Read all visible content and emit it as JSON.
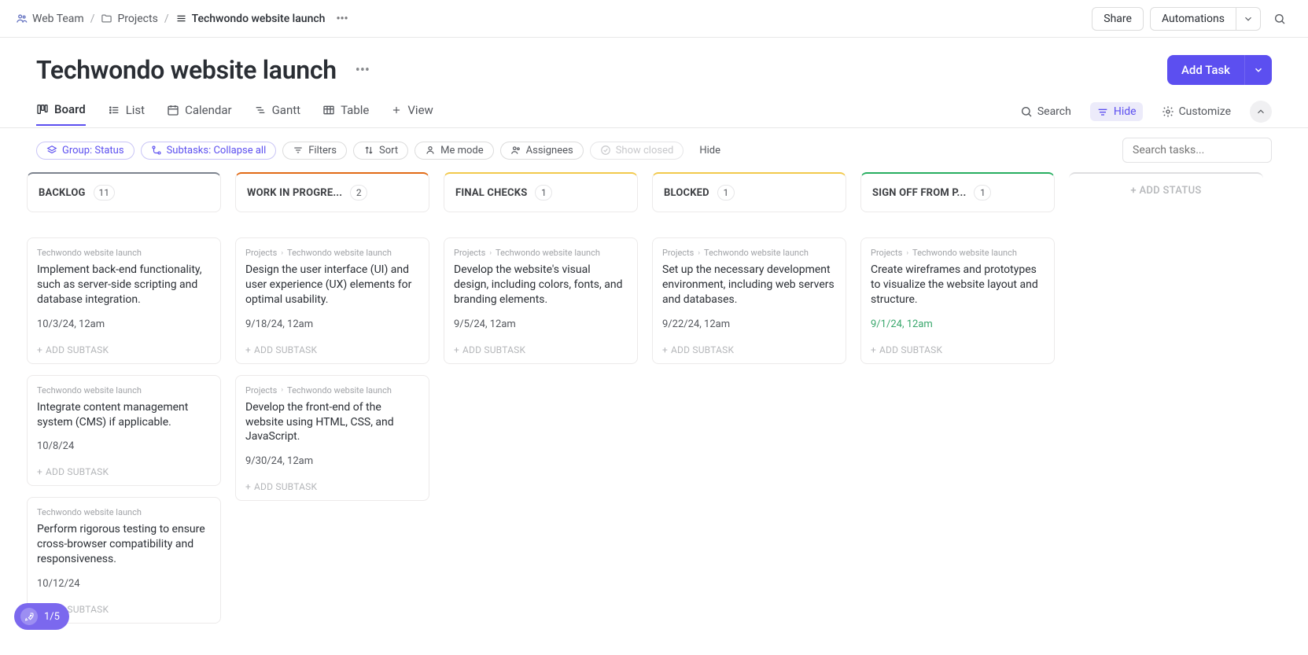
{
  "breadcrumb": {
    "team": "Web Team",
    "projects": "Projects",
    "current": "Techwondo website launch"
  },
  "header": {
    "share": "Share",
    "automations": "Automations"
  },
  "page": {
    "title": "Techwondo website launch",
    "add_task": "Add Task"
  },
  "views": {
    "board": "Board",
    "list": "List",
    "calendar": "Calendar",
    "gantt": "Gantt",
    "table": "Table",
    "view": "View",
    "search": "Search",
    "hide": "Hide",
    "customize": "Customize"
  },
  "filters": {
    "group": "Group: Status",
    "subtasks": "Subtasks: Collapse all",
    "filters": "Filters",
    "sort": "Sort",
    "me_mode": "Me mode",
    "assignees": "Assignees",
    "show_closed": "Show closed",
    "hide": "Hide",
    "search_placeholder": "Search tasks..."
  },
  "add_status": "+ ADD STATUS",
  "add_subtask": "ADD SUBTASK",
  "columns": [
    {
      "name": "BACKLOG",
      "count": "11",
      "color": "#7c828d",
      "cards": [
        {
          "crumb1": "Techwondo website launch",
          "title": "Implement back-end functionality, such as server-side scripting and database integration.",
          "date": "10/3/24, 12am"
        },
        {
          "crumb1": "Techwondo website launch",
          "title": "Integrate content management system (CMS) if applicable.",
          "date": "10/8/24"
        },
        {
          "crumb1": "Techwondo website launch",
          "title": "Perform rigorous testing to ensure cross-browser compatibility and responsiveness.",
          "date": "10/12/24"
        }
      ]
    },
    {
      "name": "WORK IN PROGRE...",
      "count": "2",
      "color": "#e16b16",
      "cards": [
        {
          "crumb0": "Projects",
          "crumb1": "Techwondo website launch",
          "title": "Design the user interface (UI) and user experience (UX) elements for optimal usability.",
          "date": "9/18/24, 12am"
        },
        {
          "crumb0": "Projects",
          "crumb1": "Techwondo website launch",
          "title": "Develop the front-end of the website using HTML, CSS, and JavaScript.",
          "date": "9/30/24, 12am"
        }
      ]
    },
    {
      "name": "FINAL CHECKS",
      "count": "1",
      "color": "#f2c94c",
      "cards": [
        {
          "crumb0": "Projects",
          "crumb1": "Techwondo website launch",
          "title": "Develop the website's visual design, including colors, fonts, and branding elements.",
          "date": "9/5/24, 12am"
        }
      ]
    },
    {
      "name": "BLOCKED",
      "count": "1",
      "color": "#f2c94c",
      "cards": [
        {
          "crumb0": "Projects",
          "crumb1": "Techwondo website launch",
          "title": "Set up the necessary development environment, including web servers and databases.",
          "date": "9/22/24, 12am"
        }
      ]
    },
    {
      "name": "SIGN OFF FROM P...",
      "count": "1",
      "color": "#27ae60",
      "cards": [
        {
          "crumb0": "Projects",
          "crumb1": "Techwondo website launch",
          "title": "Create wireframes and prototypes to visualize the website layout and structure.",
          "date": "9/1/24, 12am",
          "date_green": true
        }
      ]
    }
  ],
  "onboarding": "1/5"
}
